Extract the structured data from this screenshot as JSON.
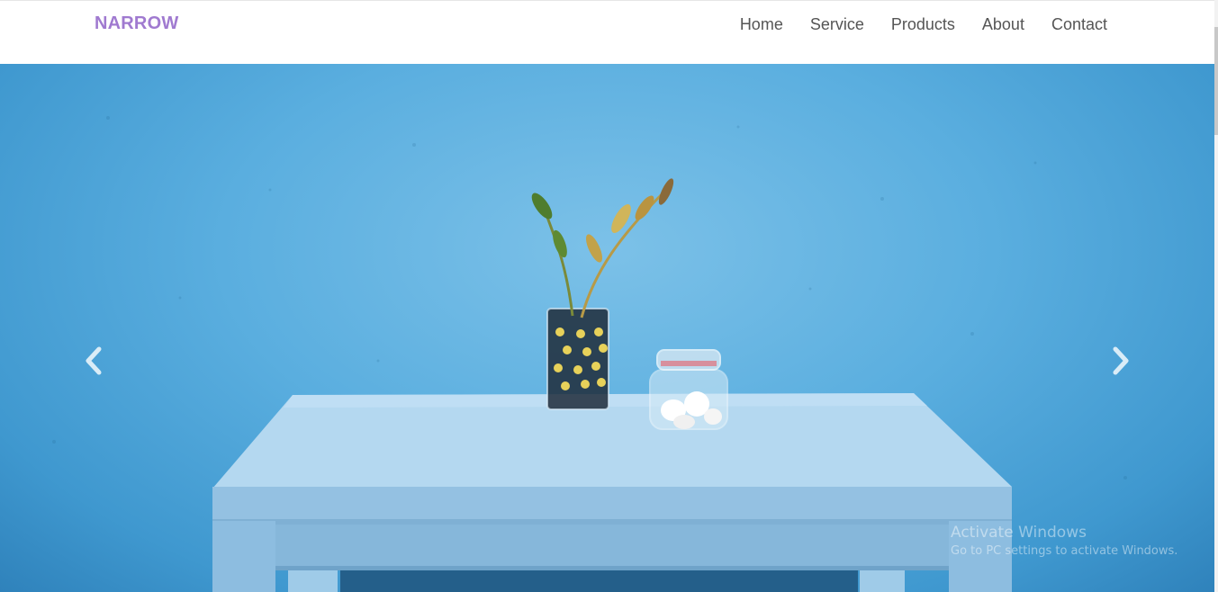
{
  "brand": {
    "name": "NARROW",
    "color": "#a07ad0"
  },
  "nav": {
    "items": [
      {
        "label": "Home"
      },
      {
        "label": "Service"
      },
      {
        "label": "Products"
      },
      {
        "label": "About"
      },
      {
        "label": "Contact"
      }
    ]
  },
  "carousel": {
    "prev_icon": "chevron-left-icon",
    "next_icon": "chevron-right-icon",
    "image_description_colors": {
      "wall": "#5aaedf",
      "table": "#a9cfe9"
    }
  },
  "watermark": {
    "title": "Activate Windows",
    "subtitle": "Go to PC settings to activate Windows."
  }
}
